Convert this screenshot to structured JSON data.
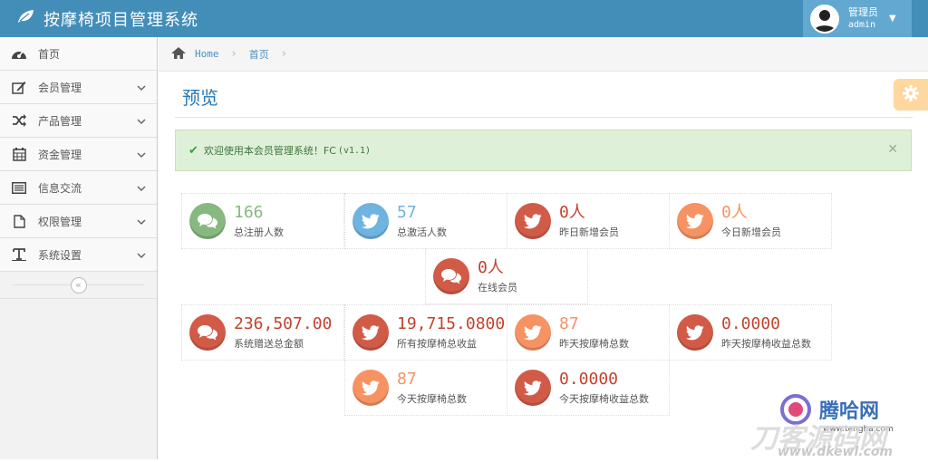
{
  "header": {
    "app_title": "按摩椅项目管理系统",
    "user_role": "管理员",
    "user_name": "admin"
  },
  "sidebar": {
    "items": [
      {
        "label": "首页",
        "icon": "dashboard-icon"
      },
      {
        "label": "会员管理",
        "icon": "edit-icon"
      },
      {
        "label": "产品管理",
        "icon": "shuffle-icon"
      },
      {
        "label": "资金管理",
        "icon": "calendar-icon"
      },
      {
        "label": "信息交流",
        "icon": "list-icon"
      },
      {
        "label": "权限管理",
        "icon": "file-icon"
      },
      {
        "label": "系统设置",
        "icon": "text-icon"
      }
    ]
  },
  "breadcrumb": {
    "home": "Home",
    "current": "首页"
  },
  "page": {
    "title": "预览"
  },
  "alert": {
    "message": "欢迎使用本会员管理系统！FC",
    "version": "(v1.1)"
  },
  "stats": [
    {
      "value": "166",
      "label": "总注册人数",
      "color": "green",
      "icon": "comments-icon"
    },
    {
      "value": "57",
      "label": "总激活人数",
      "color": "blue",
      "icon": "twitter-icon"
    },
    {
      "value": "0人",
      "label": "昨日新增会员",
      "color": "red",
      "icon": "twitter-icon"
    },
    {
      "value": "0人",
      "label": "今日新增会员",
      "color": "orange",
      "icon": "twitter-icon"
    },
    {
      "value": "0人",
      "label": "在线会员",
      "color": "red",
      "icon": "comments-icon"
    },
    {
      "value": "236,507.00",
      "label": "系统赠送总金额",
      "color": "red",
      "icon": "comments-icon"
    },
    {
      "value": "19,715.0800",
      "label": "所有按摩椅总收益",
      "color": "red",
      "icon": "twitter-icon"
    },
    {
      "value": "87",
      "label": "昨天按摩椅总数",
      "color": "orange",
      "icon": "twitter-icon"
    },
    {
      "value": "0.0000",
      "label": "昨天按摩椅收益总数",
      "color": "red",
      "icon": "twitter-icon"
    },
    {
      "value": "87",
      "label": "今天按摩椅总数",
      "color": "orange",
      "icon": "twitter-icon"
    },
    {
      "value": "0.0000",
      "label": "今天按摩椅收益总数",
      "color": "red",
      "icon": "twitter-icon"
    }
  ],
  "watermark": {
    "brand": "腾哈网",
    "url1": "www.tengha.com",
    "url2": "www.dkewl.com"
  },
  "colors": {
    "navbar": "#438eb9",
    "accent": "#2679b5",
    "green": "#87b87f",
    "blue": "#6fb3e0",
    "red": "#d15b47",
    "orange": "#f79263"
  }
}
